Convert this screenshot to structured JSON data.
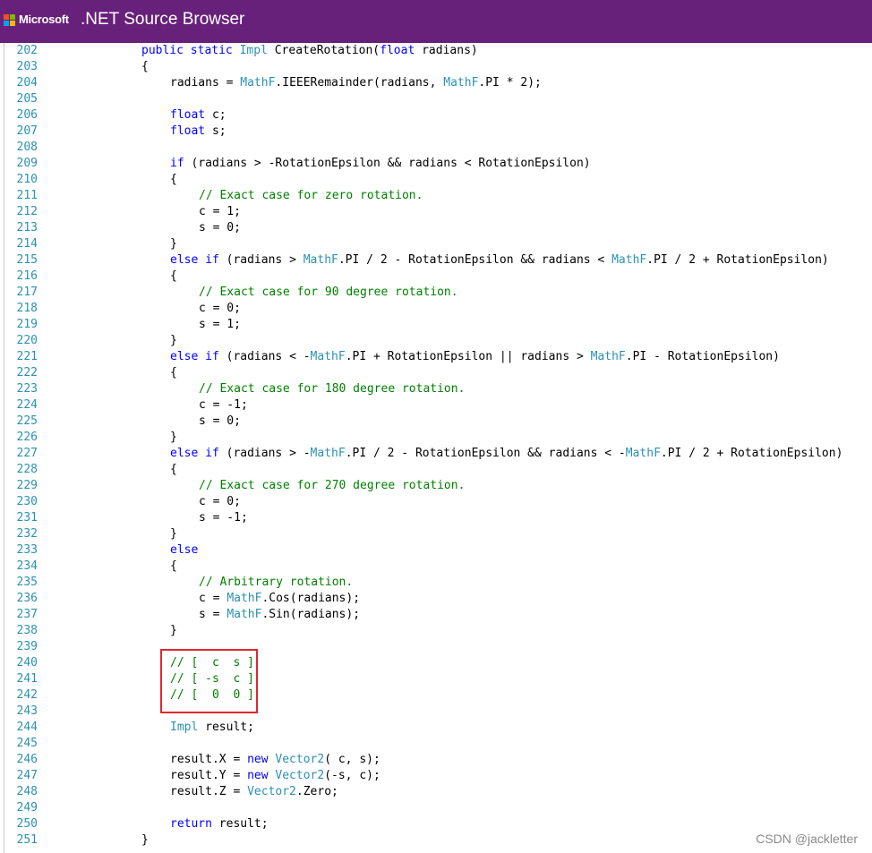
{
  "header": {
    "brand": "Microsoft",
    "title": ".NET Source Browser",
    "logo_colors": [
      "#f25022",
      "#7fba00",
      "#00a4ef",
      "#ffb900"
    ],
    "background": "#68217a"
  },
  "watermark": "CSDN @jackletter",
  "code": {
    "lines": [
      {
        "n": "202",
        "indent": 0,
        "tokens": [
          {
            "t": "kw",
            "v": "public"
          },
          {
            "t": "",
            "v": " "
          },
          {
            "t": "kw",
            "v": "static"
          },
          {
            "t": "",
            "v": " "
          },
          {
            "t": "ty",
            "v": "Impl"
          },
          {
            "t": "",
            "v": " CreateRotation("
          },
          {
            "t": "kw",
            "v": "float"
          },
          {
            "t": "",
            "v": " radians)"
          }
        ]
      },
      {
        "n": "203",
        "indent": 0,
        "tokens": [
          {
            "t": "",
            "v": "{"
          }
        ]
      },
      {
        "n": "204",
        "indent": 1,
        "tokens": [
          {
            "t": "",
            "v": "radians = "
          },
          {
            "t": "ty",
            "v": "MathF"
          },
          {
            "t": "",
            "v": ".IEEERemainder(radians, "
          },
          {
            "t": "ty",
            "v": "MathF"
          },
          {
            "t": "",
            "v": ".PI * 2);"
          }
        ]
      },
      {
        "n": "205",
        "indent": 0,
        "tokens": []
      },
      {
        "n": "206",
        "indent": 1,
        "tokens": [
          {
            "t": "kw",
            "v": "float"
          },
          {
            "t": "",
            "v": " c;"
          }
        ]
      },
      {
        "n": "207",
        "indent": 1,
        "tokens": [
          {
            "t": "kw",
            "v": "float"
          },
          {
            "t": "",
            "v": " s;"
          }
        ]
      },
      {
        "n": "208",
        "indent": 0,
        "tokens": []
      },
      {
        "n": "209",
        "indent": 1,
        "tokens": [
          {
            "t": "kw",
            "v": "if"
          },
          {
            "t": "",
            "v": " (radians > -RotationEpsilon && radians < RotationEpsilon)"
          }
        ]
      },
      {
        "n": "210",
        "indent": 1,
        "tokens": [
          {
            "t": "",
            "v": "{"
          }
        ]
      },
      {
        "n": "211",
        "indent": 2,
        "tokens": [
          {
            "t": "cm",
            "v": "// Exact case for zero rotation."
          }
        ]
      },
      {
        "n": "212",
        "indent": 2,
        "tokens": [
          {
            "t": "",
            "v": "c = 1;"
          }
        ]
      },
      {
        "n": "213",
        "indent": 2,
        "tokens": [
          {
            "t": "",
            "v": "s = 0;"
          }
        ]
      },
      {
        "n": "214",
        "indent": 1,
        "tokens": [
          {
            "t": "",
            "v": "}"
          }
        ]
      },
      {
        "n": "215",
        "indent": 1,
        "tokens": [
          {
            "t": "kw",
            "v": "else"
          },
          {
            "t": "",
            "v": " "
          },
          {
            "t": "kw",
            "v": "if"
          },
          {
            "t": "",
            "v": " (radians > "
          },
          {
            "t": "ty",
            "v": "MathF"
          },
          {
            "t": "",
            "v": ".PI / 2 - RotationEpsilon && radians < "
          },
          {
            "t": "ty",
            "v": "MathF"
          },
          {
            "t": "",
            "v": ".PI / 2 + RotationEpsilon)"
          }
        ]
      },
      {
        "n": "216",
        "indent": 1,
        "tokens": [
          {
            "t": "",
            "v": "{"
          }
        ]
      },
      {
        "n": "217",
        "indent": 2,
        "tokens": [
          {
            "t": "cm",
            "v": "// Exact case for 90 degree rotation."
          }
        ]
      },
      {
        "n": "218",
        "indent": 2,
        "tokens": [
          {
            "t": "",
            "v": "c = 0;"
          }
        ]
      },
      {
        "n": "219",
        "indent": 2,
        "tokens": [
          {
            "t": "",
            "v": "s = 1;"
          }
        ]
      },
      {
        "n": "220",
        "indent": 1,
        "tokens": [
          {
            "t": "",
            "v": "}"
          }
        ]
      },
      {
        "n": "221",
        "indent": 1,
        "tokens": [
          {
            "t": "kw",
            "v": "else"
          },
          {
            "t": "",
            "v": " "
          },
          {
            "t": "kw",
            "v": "if"
          },
          {
            "t": "",
            "v": " (radians < -"
          },
          {
            "t": "ty",
            "v": "MathF"
          },
          {
            "t": "",
            "v": ".PI + RotationEpsilon || radians > "
          },
          {
            "t": "ty",
            "v": "MathF"
          },
          {
            "t": "",
            "v": ".PI - RotationEpsilon)"
          }
        ]
      },
      {
        "n": "222",
        "indent": 1,
        "tokens": [
          {
            "t": "",
            "v": "{"
          }
        ]
      },
      {
        "n": "223",
        "indent": 2,
        "tokens": [
          {
            "t": "cm",
            "v": "// Exact case for 180 degree rotation."
          }
        ]
      },
      {
        "n": "224",
        "indent": 2,
        "tokens": [
          {
            "t": "",
            "v": "c = -1;"
          }
        ]
      },
      {
        "n": "225",
        "indent": 2,
        "tokens": [
          {
            "t": "",
            "v": "s = 0;"
          }
        ]
      },
      {
        "n": "226",
        "indent": 1,
        "tokens": [
          {
            "t": "",
            "v": "}"
          }
        ]
      },
      {
        "n": "227",
        "indent": 1,
        "tokens": [
          {
            "t": "kw",
            "v": "else"
          },
          {
            "t": "",
            "v": " "
          },
          {
            "t": "kw",
            "v": "if"
          },
          {
            "t": "",
            "v": " (radians > -"
          },
          {
            "t": "ty",
            "v": "MathF"
          },
          {
            "t": "",
            "v": ".PI / 2 - RotationEpsilon && radians < -"
          },
          {
            "t": "ty",
            "v": "MathF"
          },
          {
            "t": "",
            "v": ".PI / 2 + RotationEpsilon)"
          }
        ]
      },
      {
        "n": "228",
        "indent": 1,
        "tokens": [
          {
            "t": "",
            "v": "{"
          }
        ]
      },
      {
        "n": "229",
        "indent": 2,
        "tokens": [
          {
            "t": "cm",
            "v": "// Exact case for 270 degree rotation."
          }
        ]
      },
      {
        "n": "230",
        "indent": 2,
        "tokens": [
          {
            "t": "",
            "v": "c = 0;"
          }
        ]
      },
      {
        "n": "231",
        "indent": 2,
        "tokens": [
          {
            "t": "",
            "v": "s = -1;"
          }
        ]
      },
      {
        "n": "232",
        "indent": 1,
        "tokens": [
          {
            "t": "",
            "v": "}"
          }
        ]
      },
      {
        "n": "233",
        "indent": 1,
        "tokens": [
          {
            "t": "kw",
            "v": "else"
          }
        ]
      },
      {
        "n": "234",
        "indent": 1,
        "tokens": [
          {
            "t": "",
            "v": "{"
          }
        ]
      },
      {
        "n": "235",
        "indent": 2,
        "tokens": [
          {
            "t": "cm",
            "v": "// Arbitrary rotation."
          }
        ]
      },
      {
        "n": "236",
        "indent": 2,
        "tokens": [
          {
            "t": "",
            "v": "c = "
          },
          {
            "t": "ty",
            "v": "MathF"
          },
          {
            "t": "",
            "v": ".Cos(radians);"
          }
        ]
      },
      {
        "n": "237",
        "indent": 2,
        "tokens": [
          {
            "t": "",
            "v": "s = "
          },
          {
            "t": "ty",
            "v": "MathF"
          },
          {
            "t": "",
            "v": ".Sin(radians);"
          }
        ]
      },
      {
        "n": "238",
        "indent": 1,
        "tokens": [
          {
            "t": "",
            "v": "}"
          }
        ]
      },
      {
        "n": "239",
        "indent": 0,
        "tokens": []
      },
      {
        "n": "240",
        "indent": 1,
        "tokens": [
          {
            "t": "cm",
            "v": "// [  c  s ]"
          }
        ]
      },
      {
        "n": "241",
        "indent": 1,
        "tokens": [
          {
            "t": "cm",
            "v": "// [ -s  c ]"
          }
        ]
      },
      {
        "n": "242",
        "indent": 1,
        "tokens": [
          {
            "t": "cm",
            "v": "// [  0  0 ]"
          }
        ]
      },
      {
        "n": "243",
        "indent": 0,
        "tokens": []
      },
      {
        "n": "244",
        "indent": 1,
        "tokens": [
          {
            "t": "ty",
            "v": "Impl"
          },
          {
            "t": "",
            "v": " result;"
          }
        ]
      },
      {
        "n": "245",
        "indent": 0,
        "tokens": []
      },
      {
        "n": "246",
        "indent": 1,
        "tokens": [
          {
            "t": "",
            "v": "result.X = "
          },
          {
            "t": "kw",
            "v": "new"
          },
          {
            "t": "",
            "v": " "
          },
          {
            "t": "ty",
            "v": "Vector2"
          },
          {
            "t": "",
            "v": "( c, s);"
          }
        ]
      },
      {
        "n": "247",
        "indent": 1,
        "tokens": [
          {
            "t": "",
            "v": "result.Y = "
          },
          {
            "t": "kw",
            "v": "new"
          },
          {
            "t": "",
            "v": " "
          },
          {
            "t": "ty",
            "v": "Vector2"
          },
          {
            "t": "",
            "v": "(-s, c);"
          }
        ]
      },
      {
        "n": "248",
        "indent": 1,
        "tokens": [
          {
            "t": "",
            "v": "result.Z = "
          },
          {
            "t": "ty",
            "v": "Vector2"
          },
          {
            "t": "",
            "v": ".Zero;"
          }
        ]
      },
      {
        "n": "249",
        "indent": 0,
        "tokens": []
      },
      {
        "n": "250",
        "indent": 1,
        "tokens": [
          {
            "t": "kw",
            "v": "return"
          },
          {
            "t": "",
            "v": " result;"
          }
        ]
      },
      {
        "n": "251",
        "indent": 0,
        "tokens": [
          {
            "t": "",
            "v": "}"
          }
        ]
      }
    ],
    "highlighted_lines": [
      "240",
      "241",
      "242"
    ],
    "highlight_color": "#e0262e"
  }
}
